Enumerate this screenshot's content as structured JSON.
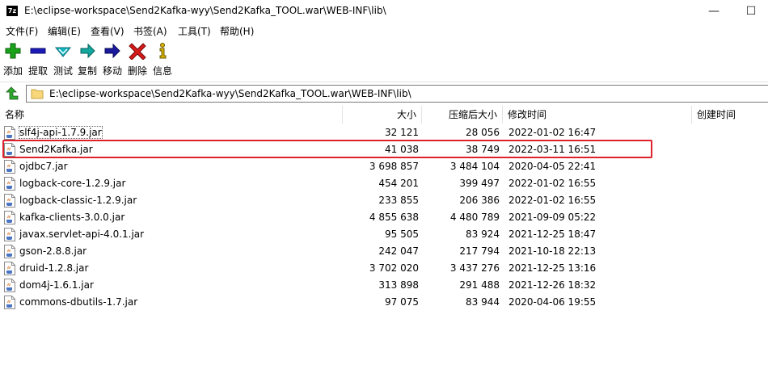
{
  "window": {
    "app_icon_text": "7z",
    "title": "E:\\eclipse-workspace\\Send2Kafka-wyy\\Send2Kafka_TOOL.war\\WEB-INF\\lib\\",
    "minimize_glyph": "—",
    "maximize_glyph": "☐"
  },
  "menu": {
    "file": "文件(F)",
    "edit": "编辑(E)",
    "view": "查看(V)",
    "bookmarks": "书签(A)",
    "tools": "工具(T)",
    "help": "帮助(H)"
  },
  "toolbar": {
    "add": "添加",
    "extract": "提取",
    "test": "测试",
    "copy": "复制",
    "move": "移动",
    "delete": "删除",
    "info": "信息",
    "colors": {
      "add": "#1aa31a",
      "extract": "#1a1ab8",
      "test": "#13b5c2",
      "copy": "#13a7a0",
      "move": "#1a1a9e",
      "delete": "#d61a1a",
      "info": "#d9b300"
    }
  },
  "address": {
    "path": "E:\\eclipse-workspace\\Send2Kafka-wyy\\Send2Kafka_TOOL.war\\WEB-INF\\lib\\"
  },
  "columns": {
    "name": "名称",
    "size": "大小",
    "packed_size": "压缩后大小",
    "modified": "修改时间",
    "created": "创建时间"
  },
  "files": [
    {
      "name": "slf4j-api-1.7.9.jar",
      "size": "32 121",
      "packed": "28 056",
      "modified": "2022-01-02 16:47"
    },
    {
      "name": "Send2Kafka.jar",
      "size": "41 038",
      "packed": "38 749",
      "modified": "2022-03-11 16:51"
    },
    {
      "name": "ojdbc7.jar",
      "size": "3 698 857",
      "packed": "3 484 104",
      "modified": "2020-04-05 22:41"
    },
    {
      "name": "logback-core-1.2.9.jar",
      "size": "454 201",
      "packed": "399 497",
      "modified": "2022-01-02 16:55"
    },
    {
      "name": "logback-classic-1.2.9.jar",
      "size": "233 855",
      "packed": "206 386",
      "modified": "2022-01-02 16:55"
    },
    {
      "name": "kafka-clients-3.0.0.jar",
      "size": "4 855 638",
      "packed": "4 480 789",
      "modified": "2021-09-09 05:22"
    },
    {
      "name": "javax.servlet-api-4.0.1.jar",
      "size": "95 505",
      "packed": "83 924",
      "modified": "2021-12-25 18:47"
    },
    {
      "name": "gson-2.8.8.jar",
      "size": "242 047",
      "packed": "217 794",
      "modified": "2021-10-18 22:13"
    },
    {
      "name": "druid-1.2.8.jar",
      "size": "3 702 020",
      "packed": "3 437 276",
      "modified": "2021-12-25 13:16"
    },
    {
      "name": "dom4j-1.6.1.jar",
      "size": "313 898",
      "packed": "291 488",
      "modified": "2021-12-26 18:32"
    },
    {
      "name": "commons-dbutils-1.7.jar",
      "size": "97 075",
      "packed": "83 944",
      "modified": "2020-04-06 19:55"
    }
  ],
  "highlight_color": "#e0212b"
}
